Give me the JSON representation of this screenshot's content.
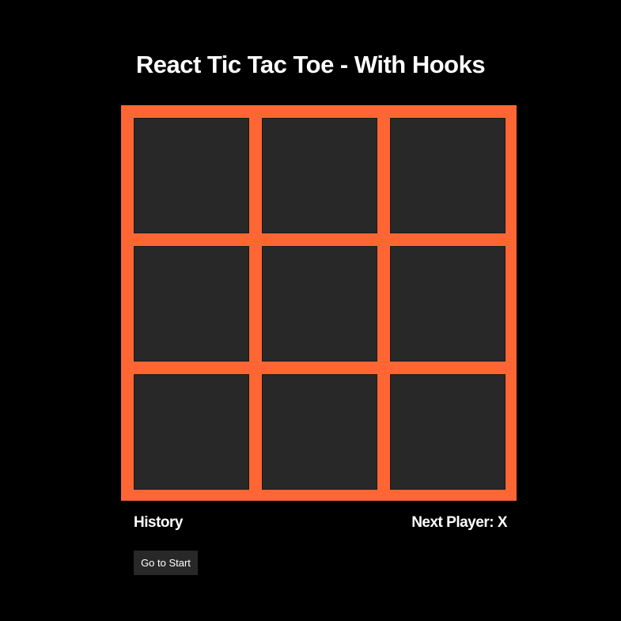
{
  "page": {
    "title": "React Tic Tac Toe - With Hooks"
  },
  "board": {
    "squares": [
      "",
      "",
      "",
      "",
      "",
      "",
      "",
      "",
      ""
    ]
  },
  "history": {
    "label": "History",
    "moves": [
      "Go to Start"
    ]
  },
  "status": {
    "next_player_text": "Next Player: X"
  },
  "colors": {
    "board_frame": "#ff6633",
    "square": "#282828",
    "background": "#000000",
    "text": "#ffffff"
  }
}
